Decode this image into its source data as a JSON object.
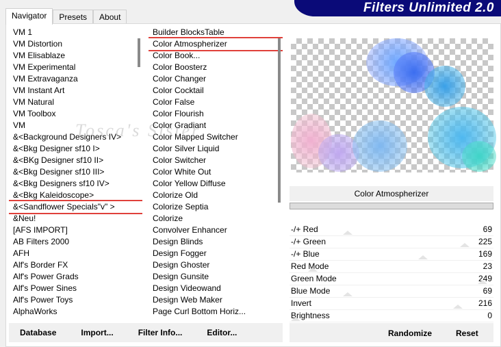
{
  "app": {
    "title": "Filters Unlimited 2.0"
  },
  "tabs": [
    {
      "label": "Navigator",
      "active": true
    },
    {
      "label": "Presets"
    },
    {
      "label": "About"
    }
  ],
  "categories": [
    "VM 1",
    "VM Distortion",
    "VM Elisablaze",
    "VM Experimental",
    "VM Extravaganza",
    "VM Instant Art",
    "VM Natural",
    "VM Toolbox",
    "VM",
    "&<Background Designers IV>",
    "&<Bkg Designer sf10 I>",
    "&<BKg Designer sf10 II>",
    "&<Bkg Designer sf10 III>",
    "&<Bkg Designers sf10 IV>",
    "&<Bkg Kaleidoscope>",
    "&<Sandflower Specials\"v\" >",
    "&Neu!",
    "[AFS IMPORT]",
    "AB Filters 2000",
    "AFH",
    "Alf's Border FX",
    "Alf's Power Grads",
    "Alf's Power Sines",
    "Alf's Power Toys",
    "AlphaWorks"
  ],
  "selected_category": "&<Sandflower Specials\"v\" >",
  "filters": [
    "Builder BlocksTable",
    "Color Atmospherizer",
    "Color Book...",
    "Color Boosterz",
    "Color Changer",
    "Color Cocktail",
    "Color False",
    "Color Flourish",
    "Color Gradiant",
    "Color Mapped Switcher",
    "Color Silver Liquid",
    "Color Switcher",
    "Color White Out",
    "Color Yellow Diffuse",
    "Colorize Old",
    "Colorize Septia",
    "Colorize",
    "Convolver Enhancer",
    "Design Blinds",
    "Design Fogger",
    "Design Ghoster",
    "Design Gunsite",
    "Design Videowand",
    "Design Web Maker",
    "Page Curl Bottom Horiz..."
  ],
  "selected_filter": "Color Atmospherizer",
  "filter_name": "Color Atmospherizer",
  "watermark": "Tosca's Sister",
  "sliders": [
    {
      "label": "-/+ Red",
      "value": 69
    },
    {
      "label": "-/+ Green",
      "value": 225
    },
    {
      "label": "-/+ Blue",
      "value": 169
    },
    {
      "label": "Red Mode",
      "value": 23
    },
    {
      "label": "Green Mode",
      "value": 249
    },
    {
      "label": "Blue Mode",
      "value": 69
    },
    {
      "label": "Invert",
      "value": 216
    },
    {
      "label": "Brightness",
      "value": 0
    }
  ],
  "buttons": {
    "database": "Database",
    "import": "Import...",
    "filter_info": "Filter Info...",
    "editor": "Editor...",
    "randomize": "Randomize",
    "reset": "Reset"
  },
  "colors": {
    "banner": "#0a0a78",
    "highlight": "#e0403a"
  }
}
